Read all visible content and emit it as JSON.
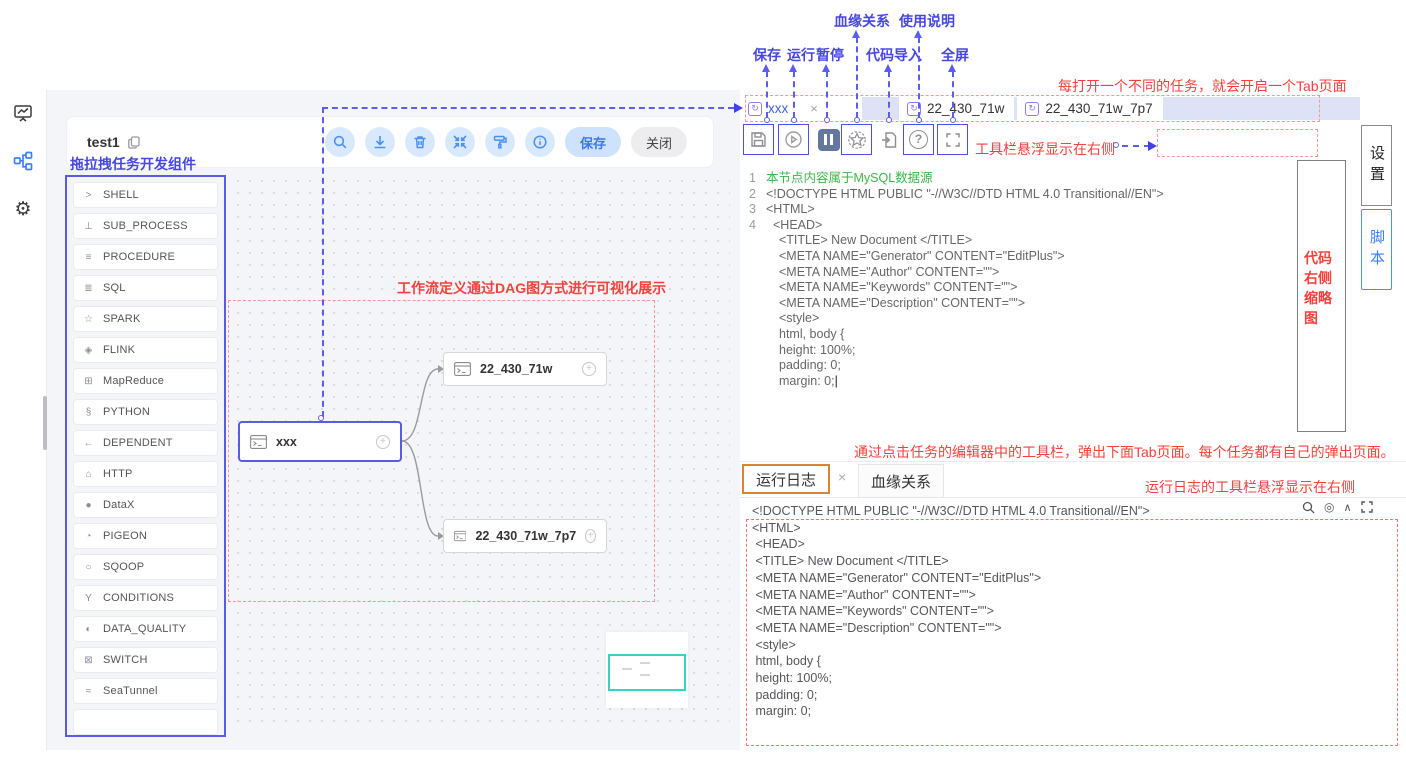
{
  "left_rail": {
    "icons": [
      "monitor",
      "workflow",
      "settings"
    ],
    "gear_glyph": "⚙"
  },
  "workflow_panel": {
    "title": "test1",
    "toolbar": {
      "save_label": "保存",
      "close_label": "关闭"
    },
    "components_annotation": "拖拉拽任务开发组件",
    "components": [
      {
        "label": "SHELL",
        "glyph": ">"
      },
      {
        "label": "SUB_PROCESS",
        "glyph": "⊥"
      },
      {
        "label": "PROCEDURE",
        "glyph": "≡"
      },
      {
        "label": "SQL",
        "glyph": "≣"
      },
      {
        "label": "SPARK",
        "glyph": "☆"
      },
      {
        "label": "FLINK",
        "glyph": "◈"
      },
      {
        "label": "MapReduce",
        "glyph": "⊞"
      },
      {
        "label": "PYTHON",
        "glyph": "§"
      },
      {
        "label": "DEPENDENT",
        "glyph": "←"
      },
      {
        "label": "HTTP",
        "glyph": "⌂"
      },
      {
        "label": "DataX",
        "glyph": "●"
      },
      {
        "label": "PIGEON",
        "glyph": "◔"
      },
      {
        "label": "SQOOP",
        "glyph": "○"
      },
      {
        "label": "CONDITIONS",
        "glyph": "Y"
      },
      {
        "label": "DATA_QUALITY",
        "glyph": "◐"
      },
      {
        "label": "SWITCH",
        "glyph": "⊠"
      },
      {
        "label": "SeaTunnel",
        "glyph": "≈"
      }
    ],
    "dag_annotation": "工作流定义通过DAG图方式进行可视化展示",
    "nodes": {
      "n1": "xxx",
      "n2": "22_430_71w",
      "n3": "22_430_71w_7p7"
    }
  },
  "editor": {
    "tabs_annotation": "每打开一个不同的任务，就会开启一个Tab页面",
    "tabs": [
      {
        "label": "xxx",
        "icon_glyph": "↻",
        "close_glyph": "×"
      },
      {
        "label": "22_430_71w",
        "icon_glyph": "↻"
      },
      {
        "label": "22_430_71w_7p7",
        "icon_glyph": "↻"
      }
    ],
    "toolbar_labels": {
      "save": "保存",
      "run": "运行",
      "pause": "暂停",
      "lineage": "血缘关系",
      "import": "代码导入",
      "help": "使用说明",
      "fullscreen": "全屏"
    },
    "toolbar_annotation": "工具栏悬浮显示在右侧",
    "question_glyph": "?",
    "minimap_annotation": "代码右侧缩略图",
    "side_tabs": {
      "settings": "设置",
      "script": "脚本"
    },
    "lines": [
      {
        "n": "1",
        "t": "本节点内容属于MySQL数据源",
        "c": "green"
      },
      {
        "n": "2",
        "t": "<!DOCTYPE HTML PUBLIC \"-//W3C//DTD HTML 4.0 Transitional//EN\">"
      },
      {
        "n": "3",
        "t": "<HTML>"
      },
      {
        "n": "4",
        "t": "<HEAD>",
        "c": "ind1"
      },
      {
        "t": "<TITLE> New Document </TITLE>",
        "c": "ind2"
      },
      {
        "t": "<META NAME=\"Generator\" CONTENT=\"EditPlus\">",
        "c": "ind2"
      },
      {
        "t": "<META NAME=\"Author\" CONTENT=\"\">",
        "c": "ind2"
      },
      {
        "t": "<META NAME=\"Keywords\" CONTENT=\"\">",
        "c": "ind2"
      },
      {
        "t": "<META NAME=\"Description\" CONTENT=\"\">",
        "c": "ind2"
      },
      {
        "t": "<style>",
        "c": "ind2"
      },
      {
        "t": "html, body {",
        "c": "ind2"
      },
      {
        "t": "height: 100%;",
        "c": "ind2"
      },
      {
        "t": "padding: 0;",
        "c": "ind2"
      },
      {
        "t": "margin: 0;",
        "c": "ind2 cursor"
      }
    ]
  },
  "bottom_panel": {
    "annotation": "通过点击任务的编辑器中的工具栏，弹出下面Tab页面。每个任务都有自己的弹出页面。",
    "tabs": {
      "log": "运行日志",
      "lineage": "血缘关系",
      "close_glyph": "×"
    },
    "log_annotation": "运行日志的工具栏悬浮显示在右侧",
    "log_tool_glyphs": {
      "target": "◎",
      "collapse": "∧"
    },
    "log_lines": [
      "<!DOCTYPE HTML PUBLIC \"-//W3C//DTD HTML 4.0 Transitional//EN\">",
      "<HTML>",
      " <HEAD>",
      " <TITLE> New Document </TITLE>",
      " <META NAME=\"Generator\" CONTENT=\"EditPlus\">",
      " <META NAME=\"Author\" CONTENT=\"\">",
      " <META NAME=\"Keywords\" CONTENT=\"\">",
      " <META NAME=\"Description\" CONTENT=\"\">",
      " <style>",
      " html, body {",
      " height: 100%;",
      " padding: 0;",
      " margin: 0;"
    ]
  },
  "colors": {
    "accent_blue": "#3a76f2",
    "annotation_blue": "#4646e0",
    "annotation_red": "#f4413c",
    "annotation_orange": "#d9833b",
    "selected_node": "#5a5ae8",
    "tabbar_bg": "#dee2f6",
    "minimap_viewport": "#3ad0c2",
    "code_comment_green": "#3cb54a"
  }
}
